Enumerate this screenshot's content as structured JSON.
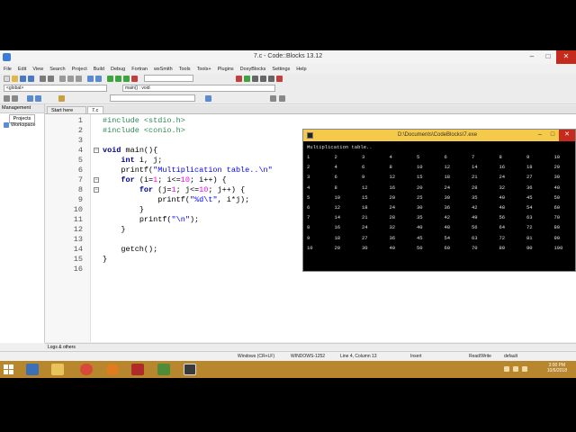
{
  "window": {
    "title": "7.c - Code::Blocks 13.12",
    "minimize_glyph": "–",
    "maximize_glyph": "□",
    "close_glyph": "✕"
  },
  "menubar": [
    "File",
    "Edit",
    "View",
    "Search",
    "Project",
    "Build",
    "Debug",
    "Fortran",
    "wxSmith",
    "Tools",
    "Tools+",
    "Plugins",
    "DoxyBlocks",
    "Settings",
    "Help"
  ],
  "toolbar": {
    "scope_combo": "<global>",
    "function_combo": "main() : void"
  },
  "management": {
    "header": "Management",
    "tab": "Projects",
    "workspace": "Workspace"
  },
  "editor_tabs": [
    {
      "label": "Start here"
    },
    {
      "label": "7.c"
    }
  ],
  "code": {
    "line_numbers": [
      "1",
      "2",
      "3",
      "4",
      "5",
      "6",
      "7",
      "8",
      "9",
      "10",
      "11",
      "12",
      "13",
      "14",
      "15",
      "16"
    ],
    "fold_symbol": "−",
    "include_kw": "#include",
    "stdio": "<stdio.h>",
    "conio": "<conio.h>",
    "void_kw": "void",
    "main_sig": "main(){",
    "int_kw": "int",
    "decl_vars": "i, j;",
    "printf_open": "printf(",
    "title_str": "\"Multiplication table..\\n\"",
    "for_kw": "for",
    "for_i_a": "(i=",
    "one": "1",
    "for_i_b": "; i<=",
    "ten": "10",
    "for_i_c": "; i++) {",
    "for_j_a": "(j=",
    "for_j_b": "; j<=",
    "for_j_c": "; j++) {",
    "fmt_str": "\"%d\\t\"",
    "printf_args_tail": ", i*j);",
    "close_brace": "}",
    "newline_str": "\"\\n\"",
    "paren_close_semicolon": ");",
    "getch_call": "getch();"
  },
  "console": {
    "title": "D:\\Documents\\CodeBlocks\\7.exe",
    "heading": "Multiplication table..",
    "rows": [
      [
        "1",
        "2",
        "3",
        "4",
        "5",
        "6",
        "7",
        "8",
        "9",
        "10"
      ],
      [
        "2",
        "4",
        "6",
        "8",
        "10",
        "12",
        "14",
        "16",
        "18",
        "20"
      ],
      [
        "3",
        "6",
        "9",
        "12",
        "15",
        "18",
        "21",
        "24",
        "27",
        "30"
      ],
      [
        "4",
        "8",
        "12",
        "16",
        "20",
        "24",
        "28",
        "32",
        "36",
        "40"
      ],
      [
        "5",
        "10",
        "15",
        "20",
        "25",
        "30",
        "35",
        "40",
        "45",
        "50"
      ],
      [
        "6",
        "12",
        "18",
        "24",
        "30",
        "36",
        "42",
        "48",
        "54",
        "60"
      ],
      [
        "7",
        "14",
        "21",
        "28",
        "35",
        "42",
        "49",
        "56",
        "63",
        "70"
      ],
      [
        "8",
        "16",
        "24",
        "32",
        "40",
        "48",
        "56",
        "64",
        "72",
        "80"
      ],
      [
        "9",
        "18",
        "27",
        "36",
        "45",
        "54",
        "63",
        "72",
        "81",
        "90"
      ],
      [
        "10",
        "20",
        "30",
        "40",
        "50",
        "60",
        "70",
        "80",
        "90",
        "100"
      ]
    ]
  },
  "logs_bar": "Logs & others",
  "status": {
    "eol": "Windows (CR+LF)",
    "encoding": "WINDOWS-1252",
    "position": "Line 4, Column 13",
    "insert": "Insert",
    "rw": "Read/Write",
    "profile": "default"
  },
  "taskbar": {
    "time": "3:00 PM",
    "date": "10/6/2018"
  },
  "colors": {
    "taskbar": "#b8862d",
    "console_title": "#f5c94a",
    "keyword": "#00008b",
    "preprocessor": "#2e8b57",
    "string": "#0000ff",
    "number": "#f000f0"
  }
}
